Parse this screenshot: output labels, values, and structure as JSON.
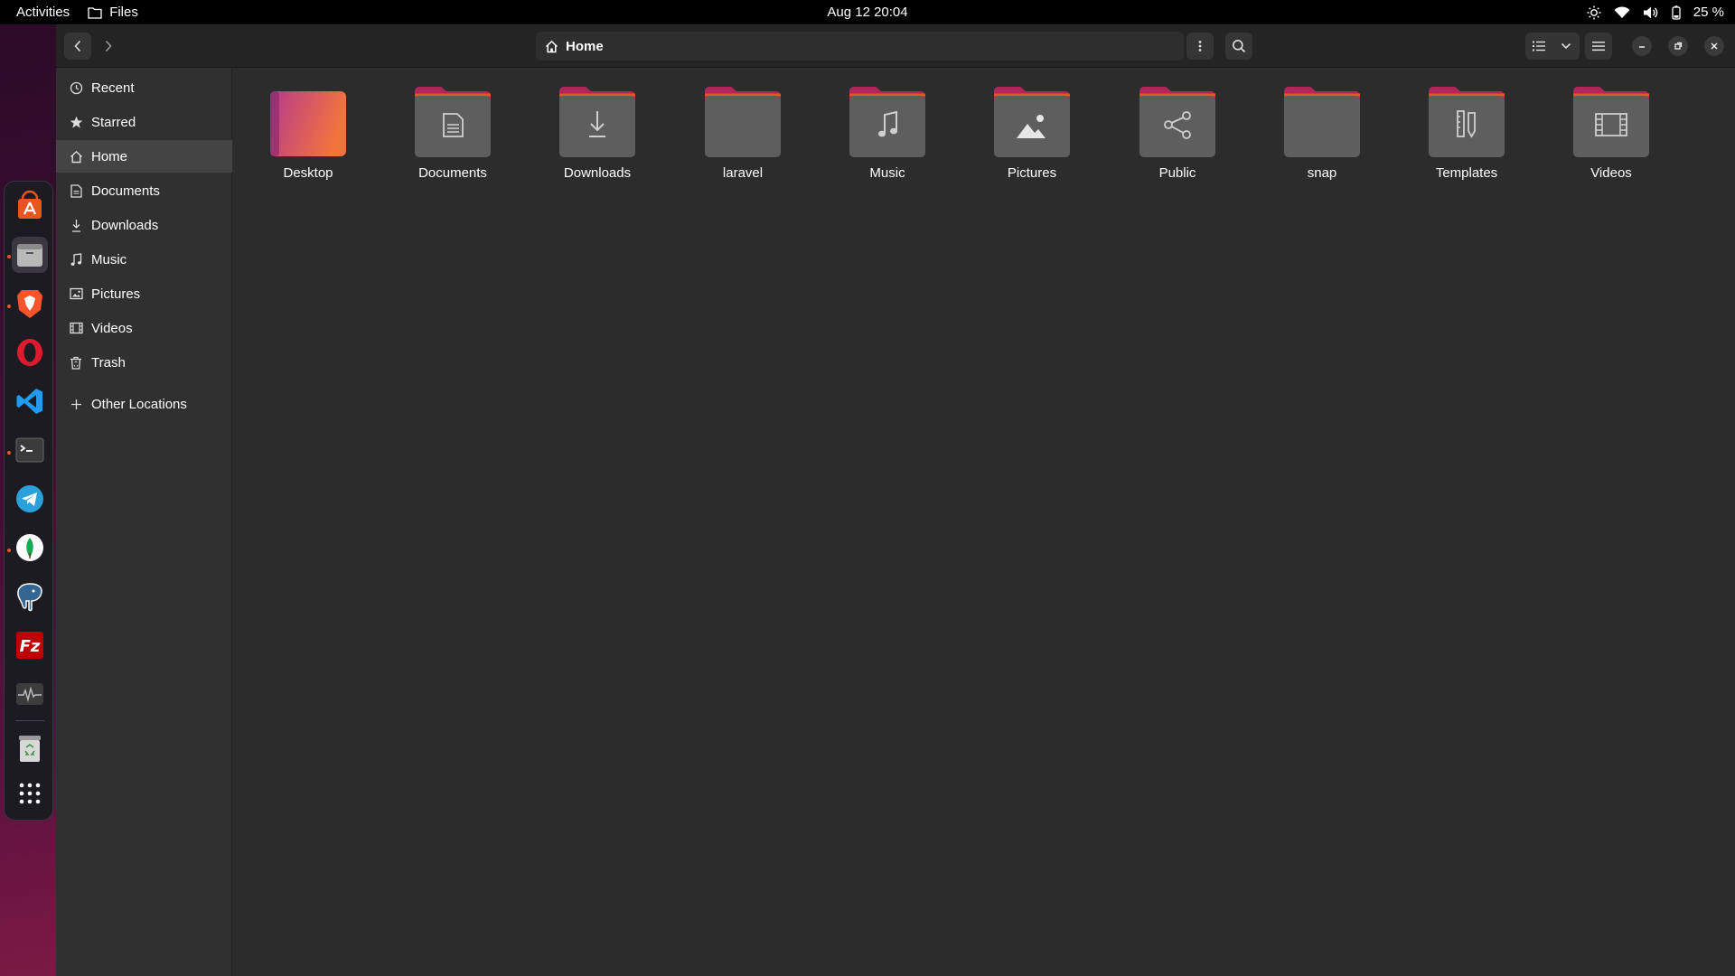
{
  "topbar": {
    "activities": "Activities",
    "app_name": "Files",
    "clock": "Aug 12  20:04",
    "battery": "25 %"
  },
  "headerbar": {
    "location": "Home"
  },
  "sidebar": {
    "items": [
      {
        "label": "Recent",
        "icon": "clock-icon"
      },
      {
        "label": "Starred",
        "icon": "star-icon"
      },
      {
        "label": "Home",
        "icon": "home-icon"
      },
      {
        "label": "Documents",
        "icon": "document-icon"
      },
      {
        "label": "Downloads",
        "icon": "download-icon"
      },
      {
        "label": "Music",
        "icon": "music-icon"
      },
      {
        "label": "Pictures",
        "icon": "picture-icon"
      },
      {
        "label": "Videos",
        "icon": "video-icon"
      },
      {
        "label": "Trash",
        "icon": "trash-icon"
      }
    ],
    "other": {
      "label": "Other Locations",
      "icon": "plus-icon"
    }
  },
  "folders": [
    {
      "name": "Desktop",
      "icon": "desktop-folder-icon"
    },
    {
      "name": "Documents",
      "icon": "documents-folder-icon"
    },
    {
      "name": "Downloads",
      "icon": "downloads-folder-icon"
    },
    {
      "name": "laravel",
      "icon": "folder-icon"
    },
    {
      "name": "Music",
      "icon": "music-folder-icon"
    },
    {
      "name": "Pictures",
      "icon": "pictures-folder-icon"
    },
    {
      "name": "Public",
      "icon": "public-folder-icon"
    },
    {
      "name": "snap",
      "icon": "folder-icon"
    },
    {
      "name": "Templates",
      "icon": "templates-folder-icon"
    },
    {
      "name": "Videos",
      "icon": "videos-folder-icon"
    }
  ],
  "dock": [
    {
      "name": "ubuntu-software-icon",
      "running": false
    },
    {
      "name": "files-icon",
      "running": true
    },
    {
      "name": "brave-browser-icon",
      "running": true
    },
    {
      "name": "opera-browser-icon",
      "running": false
    },
    {
      "name": "vscode-icon",
      "running": false
    },
    {
      "name": "terminal-icon",
      "running": true
    },
    {
      "name": "telegram-icon",
      "running": false
    },
    {
      "name": "mongodb-compass-icon",
      "running": true
    },
    {
      "name": "pgadmin-icon",
      "running": false
    },
    {
      "name": "filezilla-icon",
      "running": false
    },
    {
      "name": "system-monitor-icon",
      "running": false
    },
    {
      "name": "trash-icon",
      "running": false
    },
    {
      "name": "show-apps-icon",
      "running": false
    }
  ],
  "colors": {
    "accent": "#e95420",
    "folder_tab": "#b3265b",
    "folder_body": "#5e5e5e",
    "desktop_gradient_start": "#b73a8c",
    "desktop_gradient_end": "#f2743d"
  }
}
